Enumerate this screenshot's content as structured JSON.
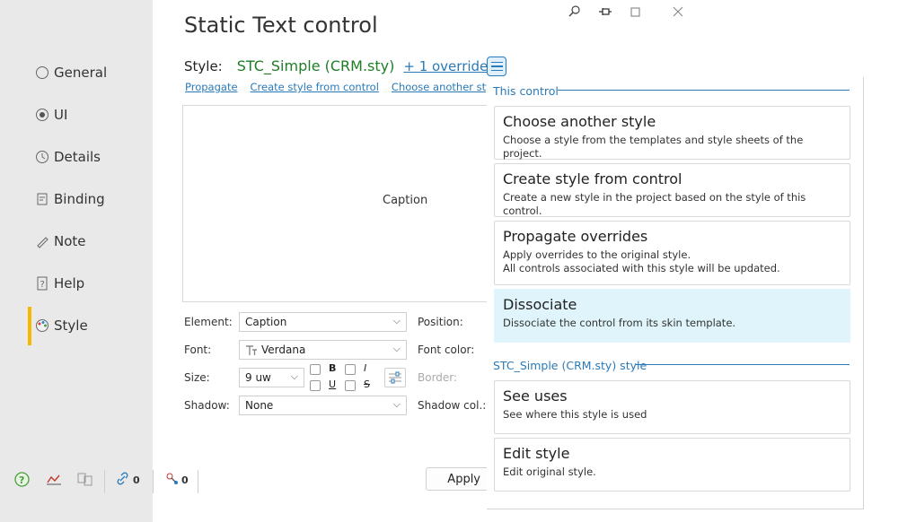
{
  "window": {
    "title": "Static Text control",
    "controls": [
      "search-icon",
      "pin-icon",
      "maximize-icon",
      "close-icon"
    ]
  },
  "sidebar": {
    "items": [
      {
        "label": "General",
        "icon": "radio-circle-icon"
      },
      {
        "label": "UI",
        "icon": "eye-icon"
      },
      {
        "label": "Details",
        "icon": "clock-icon"
      },
      {
        "label": "Binding",
        "icon": "binding-icon"
      },
      {
        "label": "Note",
        "icon": "pencil-icon"
      },
      {
        "label": "Help",
        "icon": "help-doc-icon"
      },
      {
        "label": "Style",
        "icon": "palette-icon",
        "active": true
      }
    ],
    "bottom": {
      "count1": "0",
      "count2": "0"
    }
  },
  "style_row": {
    "label": "Style:",
    "name": "STC_Simple (CRM.sty)",
    "override": "+ 1 override"
  },
  "links": {
    "propagate": "Propagate",
    "create": "Create style from control",
    "choose": "Choose another style"
  },
  "preview": {
    "caption": "Caption"
  },
  "form": {
    "element_label": "Element:",
    "element_value": "Caption",
    "position_label": "Position:",
    "font_label": "Font:",
    "font_value": "Verdana",
    "font_color_label": "Font color:",
    "size_label": "Size:",
    "size_value": "9 uw",
    "bold": "B",
    "italic": "I",
    "underline": "U",
    "strike": "S",
    "border_label": "Border:",
    "shadow_label": "Shadow:",
    "shadow_value": "None",
    "shadow_color_label": "Shadow col.:"
  },
  "apply_label": "Apply",
  "menu": {
    "section1": "This control",
    "items1": [
      {
        "title": "Choose another style",
        "desc": "Choose a style from the templates and style sheets of the project."
      },
      {
        "title": "Create style from control",
        "desc": "Create a new style in the project based on the style of this control."
      },
      {
        "title": "Propagate overrides",
        "desc": "Apply overrides to the original style.",
        "desc2": "All controls associated with this style will be updated."
      },
      {
        "title": "Dissociate",
        "desc": "Dissociate the control from its skin template.",
        "highlighted": true
      }
    ],
    "section2": "STC_Simple (CRM.sty) style",
    "items2": [
      {
        "title": "See uses",
        "desc": "See where this style is used"
      },
      {
        "title": "Edit style",
        "desc": "Edit original style."
      }
    ]
  },
  "colors": {
    "accent": "#2a7ab8",
    "style_name": "#1e7e26",
    "active_marker": "#f5b800",
    "highlight": "#dff4fb"
  }
}
